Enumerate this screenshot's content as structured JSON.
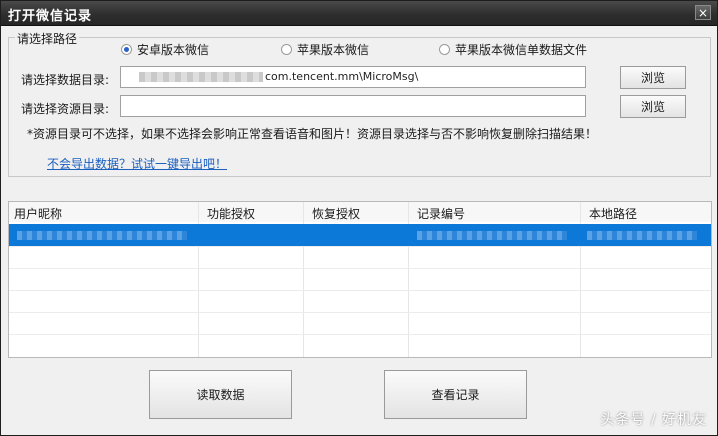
{
  "window": {
    "title": "打开微信记录",
    "close_glyph": "×"
  },
  "path_group": {
    "legend": "请选择路径",
    "options": [
      {
        "label": "安卓版本微信",
        "checked": true
      },
      {
        "label": "苹果版本微信",
        "checked": false
      },
      {
        "label": "苹果版本微信单数据文件",
        "checked": false
      }
    ],
    "data_dir_label": "请选择数据目录:",
    "data_dir_value": "com.tencent.mm\\MicroMsg\\",
    "resource_dir_label": "请选择资源目录:",
    "resource_dir_value": "",
    "browse_label": "浏览",
    "note": "*资源目录可不选择，如果不选择会影响正常查看语音和图片！资源目录选择与否不影响恢复删除扫描结果！",
    "export_link": "不会导出数据？试试一键导出吧！"
  },
  "grid": {
    "columns": [
      "用户昵称",
      "功能授权",
      "恢复授权",
      "记录编号",
      "本地路径"
    ]
  },
  "actions": {
    "read_label": "读取数据",
    "view_label": "查看记录"
  },
  "watermark": "头条号 / 好机友",
  "colors": {
    "selection": "#0c78d7",
    "titlebar": "#2e2e2e",
    "link": "#1b5fbf"
  }
}
